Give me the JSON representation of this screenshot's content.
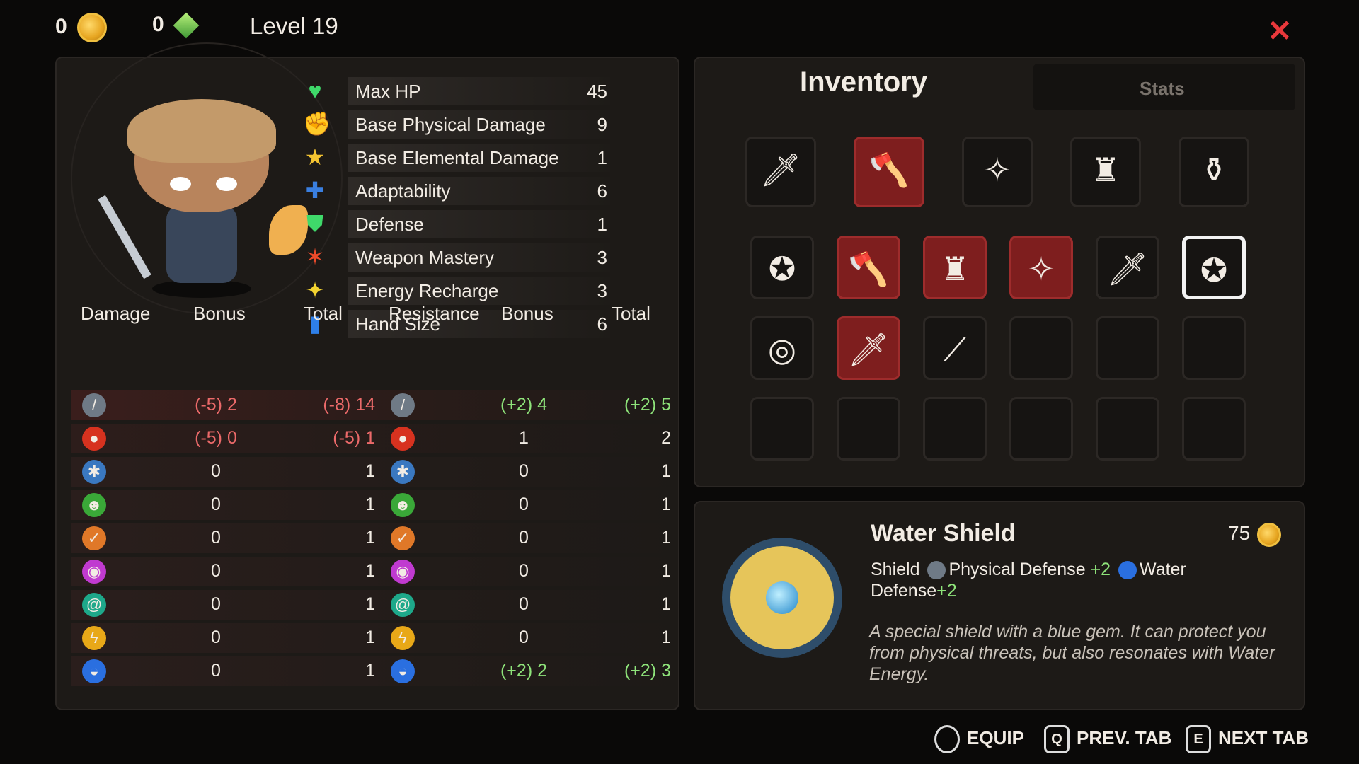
{
  "top": {
    "coins": "0",
    "gems": "0",
    "level": "Level 19"
  },
  "attributes": [
    {
      "icon": "heart-icon",
      "glyph": "♥",
      "color": "#3fd96a",
      "name": "Max HP",
      "value": "45"
    },
    {
      "icon": "fist-icon",
      "glyph": "✊",
      "color": "#ec6a3a",
      "name": "Base Physical Damage",
      "value": "9"
    },
    {
      "icon": "star-burst-icon",
      "glyph": "★",
      "color": "#f4c431",
      "name": "Base Elemental Damage",
      "value": "1"
    },
    {
      "icon": "puzzle-icon",
      "glyph": "✚",
      "color": "#3a7fe0",
      "name": "Adaptability",
      "value": "6"
    },
    {
      "icon": "shield-icon",
      "glyph": "⛊",
      "color": "#3fd96a",
      "name": "Defense",
      "value": "1"
    },
    {
      "icon": "weapon-mastery-icon",
      "glyph": "✶",
      "color": "#ec4a2a",
      "name": "Weapon Mastery",
      "value": "3"
    },
    {
      "icon": "energy-star-icon",
      "glyph": "✦",
      "color": "#f4d431",
      "name": "Energy Recharge",
      "value": "3"
    },
    {
      "icon": "cards-icon",
      "glyph": "▮",
      "color": "#2e7fe8",
      "name": "Hand Size",
      "value": "6"
    }
  ],
  "table_headers": {
    "damage": "Damage",
    "bonus1": "Bonus",
    "total1": "Total",
    "resistance": "Resistance",
    "bonus2": "Bonus",
    "total2": "Total"
  },
  "elements": [
    {
      "name": "physical",
      "icon": "physical-sword-icon",
      "color": "#6f7a86",
      "glyph": "/",
      "dmg_bonus": "(-5) 2",
      "dmg_bonus_tone": "neg",
      "dmg_total": "(-8) 14",
      "dmg_total_tone": "neg",
      "res_bonus": "(+2) 4",
      "res_bonus_tone": "pos",
      "res_total": "(+2) 5",
      "res_total_tone": "pos",
      "band": "#3a1e1c"
    },
    {
      "name": "fire",
      "icon": "fire-icon",
      "color": "#d7321f",
      "glyph": "●",
      "dmg_bonus": "(-5) 0",
      "dmg_bonus_tone": "neg",
      "dmg_total": "(-5) 1",
      "dmg_total_tone": "neg",
      "res_bonus": "1",
      "res_bonus_tone": "",
      "res_total": "2",
      "res_total_tone": "",
      "band": "#2d1d1b"
    },
    {
      "name": "ice",
      "icon": "ice-icon",
      "color": "#3a78c0",
      "glyph": "✱",
      "dmg_bonus": "0",
      "dmg_bonus_tone": "",
      "dmg_total": "1",
      "dmg_total_tone": "",
      "res_bonus": "0",
      "res_bonus_tone": "",
      "res_total": "1",
      "res_total_tone": "",
      "band": "#2a1e1c"
    },
    {
      "name": "poison",
      "icon": "poison-icon",
      "color": "#3aa838",
      "glyph": "☻",
      "dmg_bonus": "0",
      "dmg_bonus_tone": "",
      "dmg_total": "1",
      "dmg_total_tone": "",
      "res_bonus": "0",
      "res_bonus_tone": "",
      "res_total": "1",
      "res_total_tone": "",
      "band": "#2a1e1c"
    },
    {
      "name": "earth",
      "icon": "earth-icon",
      "color": "#e07828",
      "glyph": "✓",
      "dmg_bonus": "0",
      "dmg_bonus_tone": "",
      "dmg_total": "1",
      "dmg_total_tone": "",
      "res_bonus": "0",
      "res_bonus_tone": "",
      "res_total": "1",
      "res_total_tone": "",
      "band": "#2a1e1c"
    },
    {
      "name": "arcane",
      "icon": "arcane-icon",
      "color": "#c03ad0",
      "glyph": "◉",
      "dmg_bonus": "0",
      "dmg_bonus_tone": "",
      "dmg_total": "1",
      "dmg_total_tone": "",
      "res_bonus": "0",
      "res_bonus_tone": "",
      "res_total": "1",
      "res_total_tone": "",
      "band": "#2a1e1c"
    },
    {
      "name": "wind",
      "icon": "wind-icon",
      "color": "#1ea88a",
      "glyph": "@",
      "dmg_bonus": "0",
      "dmg_bonus_tone": "",
      "dmg_total": "1",
      "dmg_total_tone": "",
      "res_bonus": "0",
      "res_bonus_tone": "",
      "res_total": "1",
      "res_total_tone": "",
      "band": "#2a1e1c"
    },
    {
      "name": "lightning",
      "icon": "lightning-icon",
      "color": "#e8a818",
      "glyph": "ϟ",
      "dmg_bonus": "0",
      "dmg_bonus_tone": "",
      "dmg_total": "1",
      "dmg_total_tone": "",
      "res_bonus": "0",
      "res_bonus_tone": "",
      "res_total": "1",
      "res_total_tone": "",
      "band": "#2a1e1c"
    },
    {
      "name": "water",
      "icon": "water-icon",
      "color": "#2a6fe0",
      "glyph": "◒",
      "dmg_bonus": "0",
      "dmg_bonus_tone": "",
      "dmg_total": "1",
      "dmg_total_tone": "",
      "res_bonus": "(+2) 2",
      "res_bonus_tone": "pos",
      "res_total": "(+2) 3",
      "res_total_tone": "pos",
      "band": "#2a1e1c"
    }
  ],
  "inventory": {
    "tab_active": "Inventory",
    "tab_other": "Stats",
    "equipped": [
      {
        "icon": "sword-icon",
        "glyph": "🗡",
        "red": false
      },
      {
        "icon": "axe-icon",
        "glyph": "🪓",
        "red": true
      },
      {
        "icon": "amulet-icon",
        "glyph": "✧",
        "red": false
      },
      {
        "icon": "armor-icon",
        "glyph": "♜",
        "red": false
      },
      {
        "icon": "potion-icon",
        "glyph": "⚱",
        "red": false
      }
    ],
    "grid": [
      {
        "icon": "golden-shield-icon",
        "glyph": "✪",
        "red": false,
        "sel": false
      },
      {
        "icon": "axe-icon",
        "glyph": "🪓",
        "red": true,
        "sel": false
      },
      {
        "icon": "armor-icon",
        "glyph": "♜",
        "red": true,
        "sel": false
      },
      {
        "icon": "amulet-icon",
        "glyph": "✧",
        "red": true,
        "sel": false
      },
      {
        "icon": "golden-sword-icon",
        "glyph": "🗡",
        "red": false,
        "sel": false
      },
      {
        "icon": "water-shield-icon",
        "glyph": "✪",
        "red": false,
        "sel": true
      },
      {
        "icon": "wooden-shield-icon",
        "glyph": "◎",
        "red": false,
        "sel": false
      },
      {
        "icon": "dagger-icon",
        "glyph": "🗡",
        "red": true,
        "sel": false
      },
      {
        "icon": "staff-icon",
        "glyph": "⟋",
        "red": false,
        "sel": false
      },
      {
        "icon": "",
        "glyph": "",
        "red": false,
        "sel": false
      },
      {
        "icon": "",
        "glyph": "",
        "red": false,
        "sel": false
      },
      {
        "icon": "",
        "glyph": "",
        "red": false,
        "sel": false
      },
      {
        "icon": "",
        "glyph": "",
        "red": false,
        "sel": false
      },
      {
        "icon": "",
        "glyph": "",
        "red": false,
        "sel": false
      },
      {
        "icon": "",
        "glyph": "",
        "red": false,
        "sel": false
      },
      {
        "icon": "",
        "glyph": "",
        "red": false,
        "sel": false
      },
      {
        "icon": "",
        "glyph": "",
        "red": false,
        "sel": false
      },
      {
        "icon": "",
        "glyph": "",
        "red": false,
        "sel": false
      }
    ]
  },
  "detail": {
    "title": "Water Shield",
    "price": "75",
    "type": "Shield",
    "stat1_label": "Physical Defense",
    "stat1_value": "+2",
    "stat2_label_a": "Water",
    "stat2_label_b": "Defense",
    "stat2_value": "+2",
    "flavor": "A special shield with a blue gem. It can protect you from physical threats, but also resonates with Water Energy."
  },
  "controls": {
    "equip": "EQUIP",
    "prev_key": "Q",
    "prev": "PREV. TAB",
    "next_key": "E",
    "next": "NEXT TAB"
  }
}
